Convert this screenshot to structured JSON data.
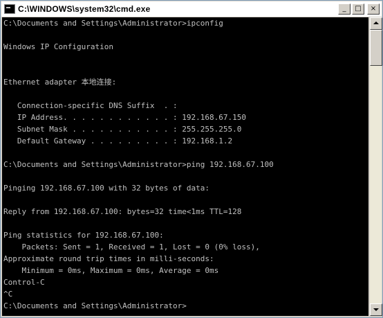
{
  "window": {
    "title": "C:\\WINDOWS\\system32\\cmd.exe",
    "buttons": {
      "minimize": "_",
      "maximize": "□",
      "close": "×"
    }
  },
  "console": {
    "lines": [
      "C:\\Documents and Settings\\Administrator>ipconfig",
      "",
      "Windows IP Configuration",
      "",
      "",
      "Ethernet adapter 本地连接:",
      "",
      "   Connection-specific DNS Suffix  . :",
      "   IP Address. . . . . . . . . . . . : 192.168.67.150",
      "   Subnet Mask . . . . . . . . . . . : 255.255.255.0",
      "   Default Gateway . . . . . . . . . : 192.168.1.2",
      "",
      "C:\\Documents and Settings\\Administrator>ping 192.168.67.100",
      "",
      "Pinging 192.168.67.100 with 32 bytes of data:",
      "",
      "Reply from 192.168.67.100: bytes=32 time<1ms TTL=128",
      "",
      "Ping statistics for 192.168.67.100:",
      "    Packets: Sent = 1, Received = 1, Lost = 0 (0% loss),",
      "Approximate round trip times in milli-seconds:",
      "    Minimum = 0ms, Maximum = 0ms, Average = 0ms",
      "Control-C",
      "^C",
      "C:\\Documents and Settings\\Administrator>"
    ]
  },
  "colors": {
    "console_background": "#000000",
    "console_text": "#c0c0c0"
  }
}
